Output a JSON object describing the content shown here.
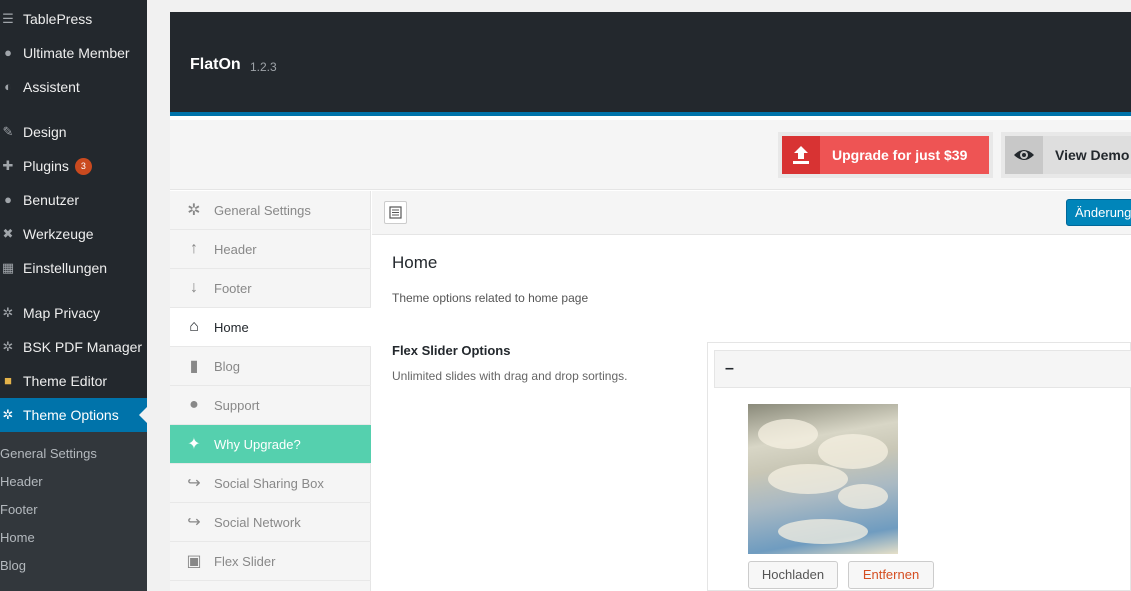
{
  "wp_menu": {
    "items": [
      {
        "label": "TablePress",
        "icon": "table-icon"
      },
      {
        "label": "Ultimate Member",
        "icon": "user-icon"
      },
      {
        "label": "Assistent",
        "icon": "wizard-icon"
      },
      {
        "label": "Design",
        "icon": "brush-icon"
      },
      {
        "label": "Plugins",
        "icon": "plugin-icon",
        "badge": "3"
      },
      {
        "label": "Benutzer",
        "icon": "users-icon"
      },
      {
        "label": "Werkzeuge",
        "icon": "wrench-icon"
      },
      {
        "label": "Einstellungen",
        "icon": "settings-icon"
      },
      {
        "label": "Map Privacy",
        "icon": "gear-icon"
      },
      {
        "label": "BSK PDF Manager",
        "icon": "gear-icon"
      },
      {
        "label": "Theme Editor",
        "icon": "folder-icon"
      },
      {
        "label": "Theme Options",
        "icon": "gear-icon",
        "active": true
      }
    ],
    "submenu": [
      "General Settings",
      "Header",
      "Footer",
      "Home",
      "Blog"
    ]
  },
  "header": {
    "theme_name": "FlatOn",
    "version": "1.2.3"
  },
  "actions": {
    "upgrade_label": "Upgrade for just $39",
    "demo_label": "View Demo"
  },
  "options_nav": [
    {
      "label": "General Settings",
      "icon": "gears-icon"
    },
    {
      "label": "Header",
      "icon": "arrow-up-icon"
    },
    {
      "label": "Footer",
      "icon": "arrow-down-icon"
    },
    {
      "label": "Home",
      "icon": "home-icon",
      "active": true
    },
    {
      "label": "Blog",
      "icon": "file-icon"
    },
    {
      "label": "Support",
      "icon": "user-icon"
    },
    {
      "label": "Why Upgrade?",
      "icon": "magic-wand-icon",
      "highlight": true
    },
    {
      "label": "Social Sharing Box",
      "icon": "share-icon"
    },
    {
      "label": "Social Network",
      "icon": "share-icon"
    },
    {
      "label": "Flex Slider",
      "icon": "image-icon"
    }
  ],
  "toolbar": {
    "save_label": "Änderungen speichern"
  },
  "content": {
    "section_title": "Home",
    "section_desc": "Theme options related to home page",
    "field_title": "Flex Slider Options",
    "field_desc": "Unlimited slides with drag and drop sortings.",
    "slide_toggle": "–",
    "upload_label": "Hochladen",
    "remove_label": "Entfernen"
  },
  "colors": {
    "sidebar_bg": "#23282d",
    "active_blue": "#0073aa",
    "upgrade_red": "#ee5454",
    "upgrade_green": "#55d0ae",
    "badge_orange": "#ca4a1f"
  }
}
